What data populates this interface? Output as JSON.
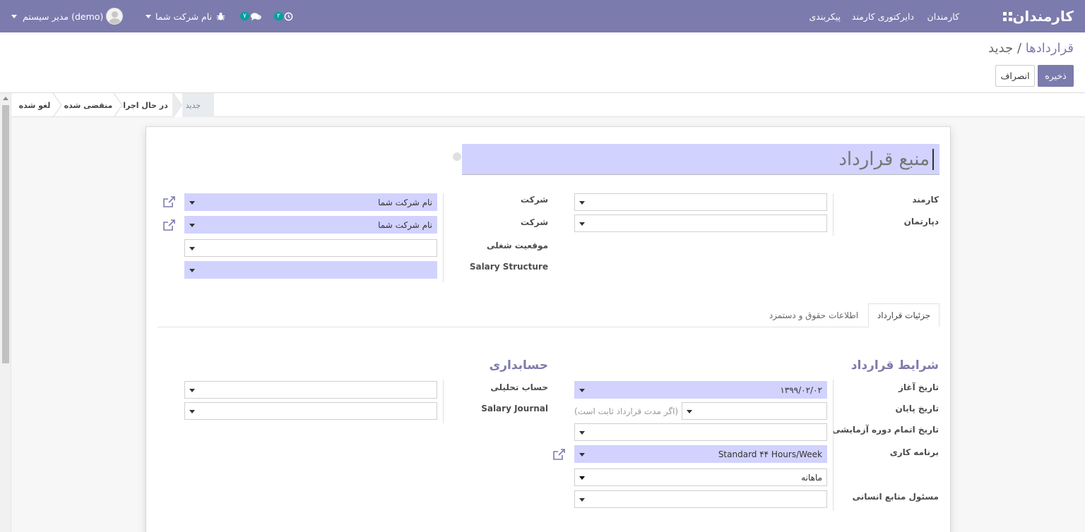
{
  "topbar": {
    "brand": "کارمندان",
    "menu": [
      "کارمندان",
      "دایرکتوری کارمند",
      "پیکربندی"
    ],
    "activity_badge": "۲",
    "messages_badge": "۷",
    "company": "نام شرکت شما",
    "user": "مدیر سیستم (demo)",
    "bg_color": "#7c7bad"
  },
  "breadcrumb": {
    "parent": "قراردادها",
    "separator": "/",
    "current": "جدید"
  },
  "buttons": {
    "save": "ذخیره",
    "discard": "انصراف"
  },
  "stages": [
    "جدید",
    "در حال اجرا",
    "منقضی شده",
    "لغو شده"
  ],
  "form": {
    "title_placeholder": "منبع قرارداد",
    "labels": {
      "employee": "کارمند",
      "department": "دپارتمان",
      "company1": "شرکت",
      "company2": "شرکت",
      "job": "موقعیت شغلی",
      "salary_structure": "Salary Structure"
    },
    "values": {
      "company1": "نام شرکت شما",
      "company2": "نام شرکت شما"
    }
  },
  "tabs": [
    "جزئیات قرارداد",
    "اطلاعات حقوق و دستمزد"
  ],
  "contract_terms": {
    "heading": "شرایط قرارداد",
    "start_date_label": "تاریخ آغاز",
    "start_date": "۱۳۹۹/۰۲/۰۲",
    "end_date_label": "تاریخ پایان",
    "end_date_hint": "(اگر مدت قرارداد ثابت است)",
    "trial_end_label": "تاریخ اتمام دوره آزمایشی",
    "schedule_label": "برنامه کاری",
    "schedule": "Standard ۴۴ Hours/Week",
    "pay_period": "ماهانه",
    "hr_responsible_label": "مسئول منابع انسانی"
  },
  "accounting": {
    "heading": "حسابداری",
    "analytic_label": "حساب تحلیلی",
    "journal_label": "Salary Journal"
  }
}
